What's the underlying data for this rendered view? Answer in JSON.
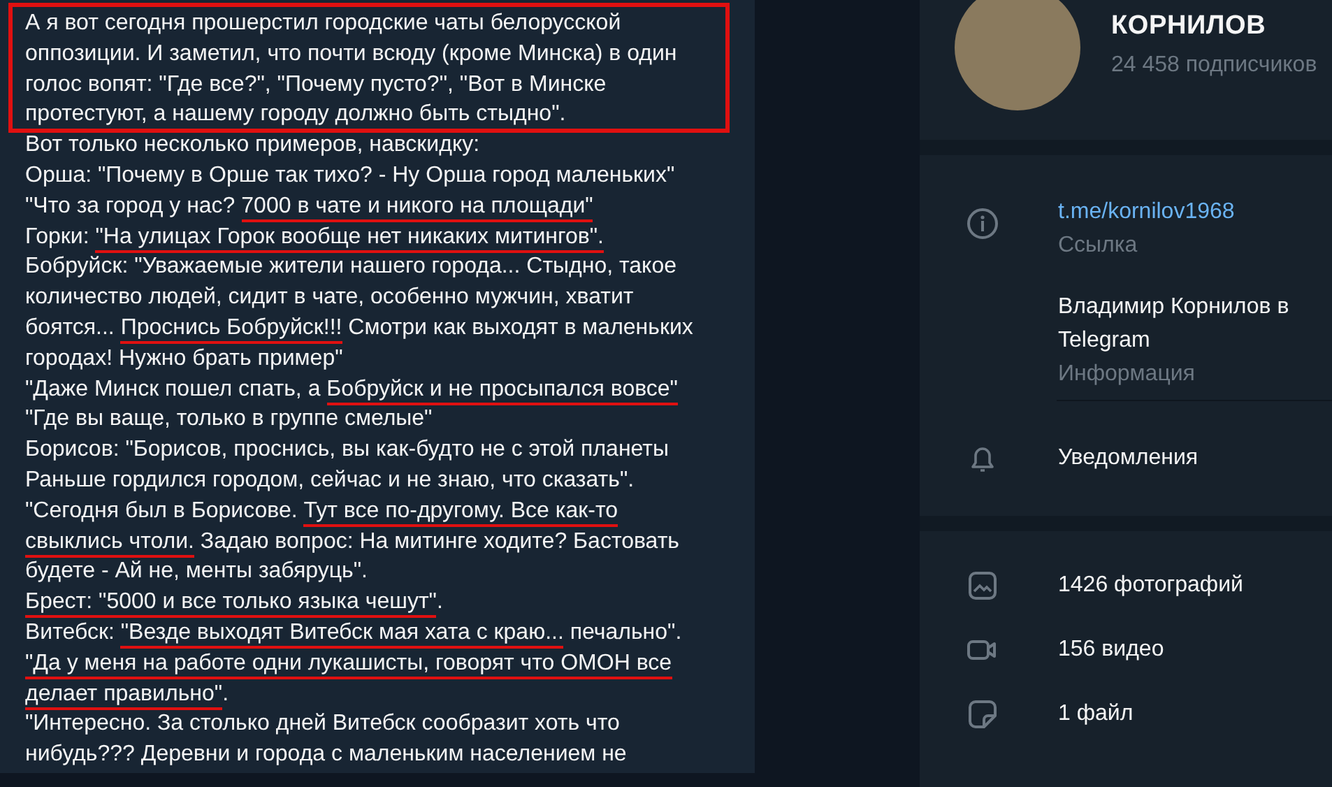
{
  "message": {
    "boxed_lines": [
      {
        "segments": [
          {
            "text": "А я вот сегодня прошерстил городские чаты белорусской",
            "underlined": false
          }
        ]
      },
      {
        "segments": [
          {
            "text": "оппозиции. И заметил, что почти всюду (кроме Минска) в один",
            "underlined": false
          }
        ]
      },
      {
        "segments": [
          {
            "text": "голос вопят: \"Где все?\", \"Почему пусто?\", \"Вот в Минске",
            "underlined": false
          }
        ]
      },
      {
        "segments": [
          {
            "text": "протестуют, а нашему городу должно быть стыдно\".",
            "underlined": false
          }
        ]
      }
    ],
    "lines": [
      {
        "segments": [
          {
            "text": "Вот только несколько примеров, навскидку:",
            "underlined": false
          }
        ]
      },
      {
        "segments": [
          {
            "text": "Орша: \"Почему в Орше так тихо? - Ну Орша город маленьких\"",
            "underlined": false
          }
        ]
      },
      {
        "segments": [
          {
            "text": "\"Что за город у нас? ",
            "underlined": false
          },
          {
            "text": "7000 в чате и никого на площади\"",
            "underlined": true
          }
        ]
      },
      {
        "segments": [
          {
            "text": "Горки: ",
            "underlined": false
          },
          {
            "text": "\"На улицах Горок вообще нет никаких митингов\".",
            "underlined": true
          }
        ]
      },
      {
        "segments": [
          {
            "text": "Бобруйск: \"Уважаемые жители нашего города... Стыдно, такое",
            "underlined": false
          }
        ]
      },
      {
        "segments": [
          {
            "text": "количество людей, сидит в чате, особенно мужчин, хватит",
            "underlined": false
          }
        ]
      },
      {
        "segments": [
          {
            "text": "боятся... ",
            "underlined": false
          },
          {
            "text": "Проснись Бобруйск!!!",
            "underlined": true
          },
          {
            "text": " Смотри как выходят в маленьких",
            "underlined": false
          }
        ]
      },
      {
        "segments": [
          {
            "text": "городах! Нужно брать пример\"",
            "underlined": false
          }
        ]
      },
      {
        "segments": [
          {
            "text": "\"Даже Минск пошел спать, а ",
            "underlined": false
          },
          {
            "text": "Бобруйск и не просыпался вовсе\"",
            "underlined": true
          }
        ]
      },
      {
        "segments": [
          {
            "text": "\"Где вы ваще, только в группе смелые\"",
            "underlined": false
          }
        ]
      },
      {
        "segments": [
          {
            "text": "Борисов: \"Борисов, проснись, вы как-будто не с этой планеты",
            "underlined": false
          }
        ]
      },
      {
        "segments": [
          {
            "text": "Раньше гордился городом, сейчас и не знаю, что сказать\".",
            "underlined": false
          }
        ]
      },
      {
        "segments": [
          {
            "text": "\"Сегодня был в Борисове. ",
            "underlined": false
          },
          {
            "text": "Тут все по-другому. Все как-то",
            "underlined": true
          }
        ]
      },
      {
        "segments": [
          {
            "text": "свыклись чтоли.",
            "underlined": true
          },
          {
            "text": " Задаю вопрос: На митинге ходите? Бастовать",
            "underlined": false
          }
        ]
      },
      {
        "segments": [
          {
            "text": "будете - Ай не, менты забяруць\".",
            "underlined": false
          }
        ]
      },
      {
        "segments": [
          {
            "text": "Брест: \"5000 и все только языка чешут\"",
            "underlined": true
          },
          {
            "text": ".",
            "underlined": false
          }
        ]
      },
      {
        "segments": [
          {
            "text": "Витебск: ",
            "underlined": false
          },
          {
            "text": "\"Везде выходят Витебск мая хата с краю...",
            "underlined": true
          },
          {
            "text": " печально\".",
            "underlined": false
          }
        ]
      },
      {
        "segments": [
          {
            "text": "\"Да у меня на работе одни лукашисты, говорят что ОМОН все",
            "underlined": true
          }
        ]
      },
      {
        "segments": [
          {
            "text": "делает правильно\"",
            "underlined": true
          },
          {
            "text": ".",
            "underlined": false
          }
        ]
      },
      {
        "segments": [
          {
            "text": "\"Интересно. За столько дней Витебск сообразит хоть что",
            "underlined": false
          }
        ]
      },
      {
        "segments": [
          {
            "text": "нибудь??? Деревни и города с маленьким населением не",
            "underlined": false
          }
        ]
      }
    ]
  },
  "profile": {
    "name": "КОРНИЛОВ",
    "subscribers": "24 458 подписчиков"
  },
  "info": {
    "link": "t.me/kornilov1968",
    "link_label": "Ссылка",
    "description": "Владимир Корнилов в Telegram",
    "description_label": "Информация"
  },
  "notifications": {
    "label": "Уведомления"
  },
  "media": [
    {
      "kind": "photo",
      "label": "1426 фотографий"
    },
    {
      "kind": "video",
      "label": "156 видео"
    },
    {
      "kind": "file",
      "label": "1 файл"
    }
  ]
}
